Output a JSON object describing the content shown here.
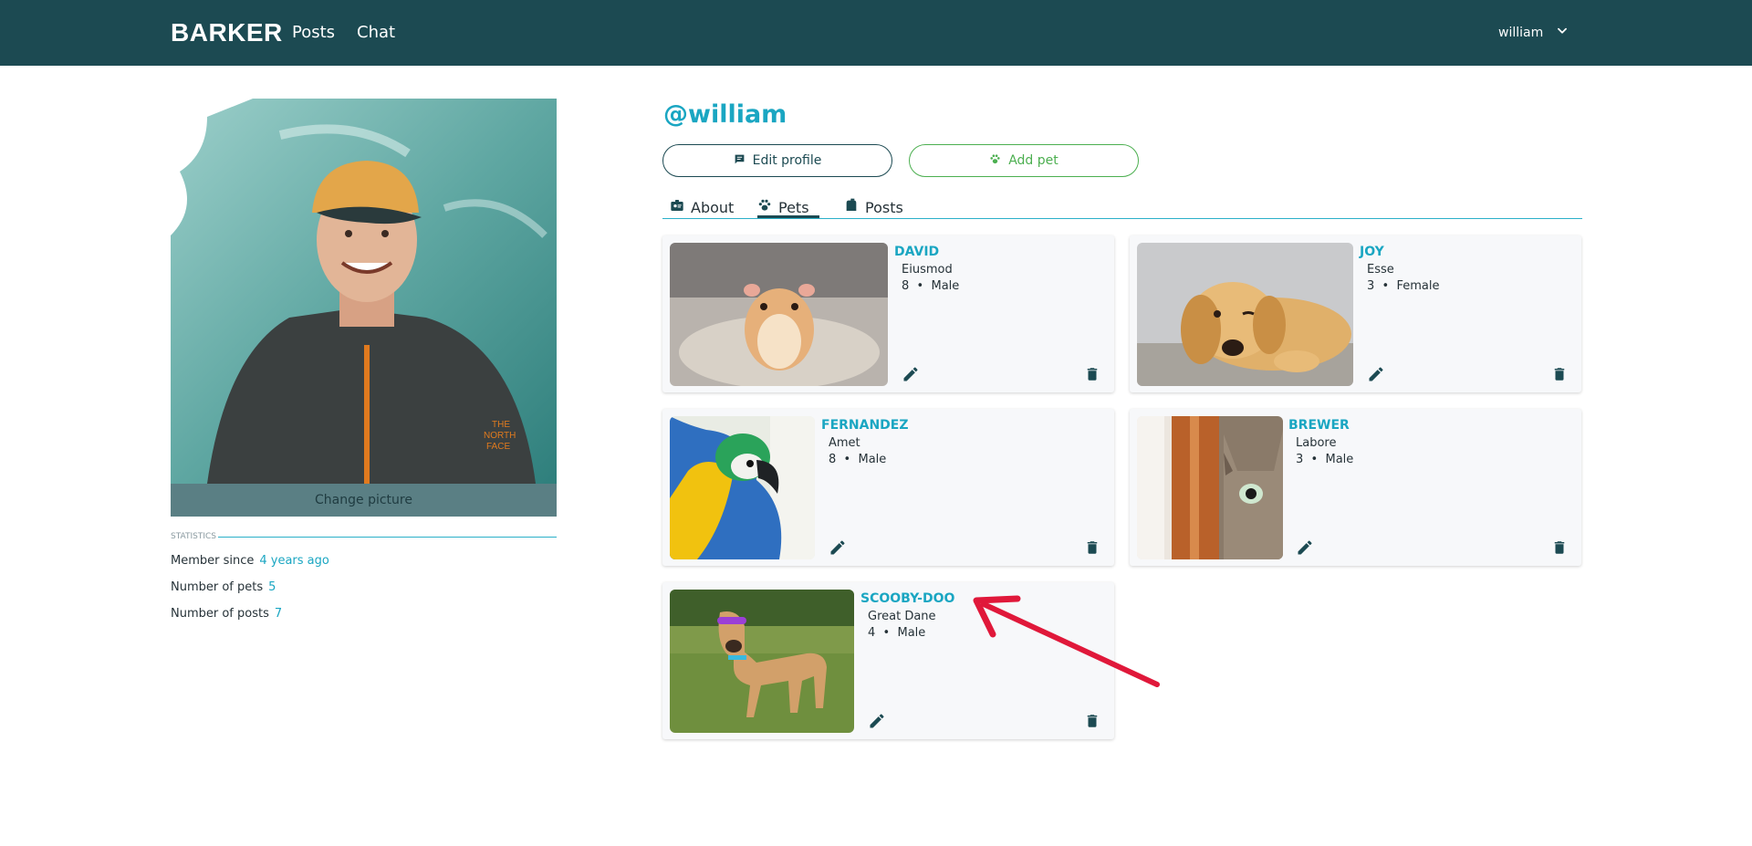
{
  "colors": {
    "topbar": "#1c4a52",
    "accent": "#1aa6c2",
    "primary": "#1c4a52",
    "success": "#4caf50",
    "annotation_arrow": "#e0183a"
  },
  "navbar": {
    "brand": "BARKER",
    "links": [
      "Posts",
      "Chat"
    ],
    "user": "william",
    "user_menu_icon": "chevron-down-icon"
  },
  "profile": {
    "change_picture_label": "Change picture",
    "username": "@william",
    "edit_profile_label": "Edit profile",
    "add_pet_label": "Add pet"
  },
  "statistics": {
    "heading": "STATISTICS",
    "rows": [
      {
        "label": "Member since",
        "value": "4 years ago"
      },
      {
        "label": "Number of pets",
        "value": "5"
      },
      {
        "label": "Number of posts",
        "value": "7"
      }
    ]
  },
  "tabs": [
    {
      "label": "About",
      "icon": "id-badge-icon",
      "active": false
    },
    {
      "label": "Pets",
      "icon": "paw-icon",
      "active": true
    },
    {
      "label": "Posts",
      "icon": "mailbox-icon",
      "active": false
    }
  ],
  "pets": [
    {
      "name": "DAVID",
      "breed": "Eiusmod",
      "age": "8",
      "gender": "Male",
      "image": "hamster"
    },
    {
      "name": "JOY",
      "breed": "Esse",
      "age": "3",
      "gender": "Female",
      "image": "golden retriever puppy"
    },
    {
      "name": "FERNANDEZ",
      "breed": "Amet",
      "age": "8",
      "gender": "Male",
      "image": "macaw parrot"
    },
    {
      "name": "BREWER",
      "breed": "Labore",
      "age": "3",
      "gender": "Male",
      "image": "tabby cat peeking"
    },
    {
      "name": "SCOOBY-DOO",
      "breed": "Great Dane",
      "age": "4",
      "gender": "Male",
      "image": "dog with sunglasses"
    }
  ],
  "meta_separator": "•"
}
